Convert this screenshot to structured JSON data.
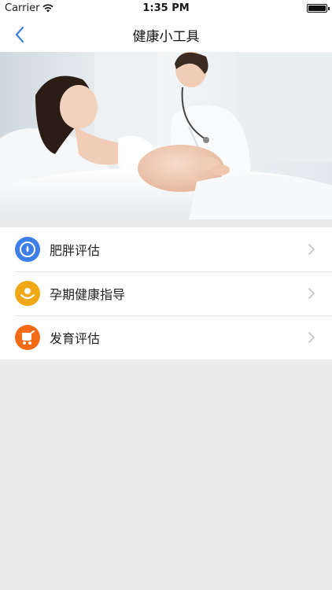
{
  "statusbar": {
    "carrier": "Carrier",
    "time": "1:35 PM"
  },
  "navbar": {
    "title": "健康小工具"
  },
  "menu": [
    {
      "label": "肥胖评估",
      "icon": "obesity-scale-icon",
      "color": "#3d7ee8"
    },
    {
      "label": "孕期健康指导",
      "icon": "pregnancy-guidance-icon",
      "color": "#f0a817"
    },
    {
      "label": "发育评估",
      "icon": "stroller-icon",
      "color": "#f36b17"
    }
  ],
  "colors": {
    "accent": "#3d7ee8",
    "background": "#ececec"
  }
}
